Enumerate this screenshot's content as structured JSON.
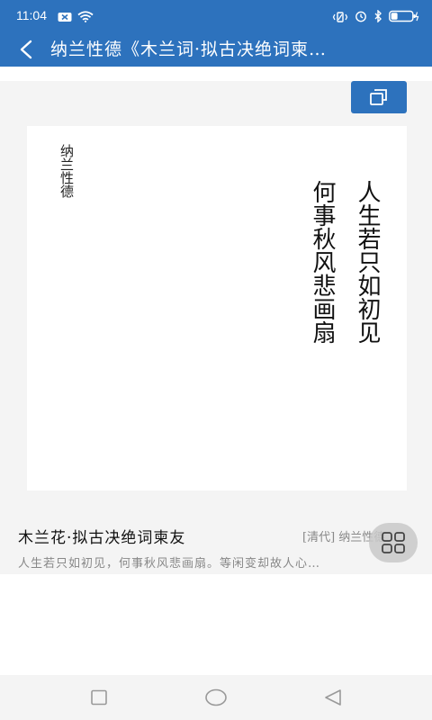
{
  "status_bar": {
    "time": "11:04",
    "left_icons": [
      "notification-x-icon",
      "wifi-icon"
    ],
    "right_icons": [
      "vibrate-icon",
      "alarm-icon",
      "bluetooth-icon",
      "battery-icon"
    ]
  },
  "header": {
    "back_icon": "chevron-left-icon",
    "title": "纳兰性德《木兰词·拟古决绝词柬…"
  },
  "copy_button": {
    "icon": "copy-icon"
  },
  "poem_card": {
    "author_vertical": "纳兰性德",
    "line1": "人生若只如初见",
    "line2": "何事秋风悲画扇"
  },
  "poem_info": {
    "title": "木兰花·拟古决绝词柬友",
    "meta": "[清代] 纳兰性德",
    "excerpt": "人生若只如初见，何事秋风悲画扇。等闲变却故人心…"
  },
  "floating_button": {
    "icon": "grid-icon"
  },
  "nav_bar": {
    "icons": [
      "recent-apps-icon",
      "home-icon",
      "back-icon"
    ]
  },
  "colors": {
    "accent": "#2d72bd",
    "background": "#f4f4f4",
    "card": "#ffffff"
  }
}
